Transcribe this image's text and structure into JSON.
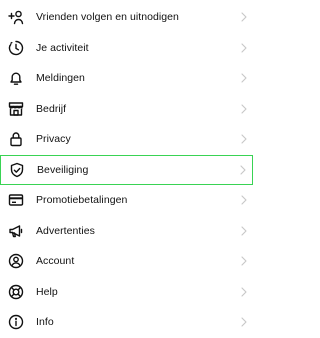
{
  "menu": {
    "items": [
      {
        "label": "Vrienden volgen en uitnodigen",
        "icon": "add-person-icon"
      },
      {
        "label": "Je activiteit",
        "icon": "activity-clock-icon"
      },
      {
        "label": "Meldingen",
        "icon": "bell-icon"
      },
      {
        "label": "Bedrijf",
        "icon": "store-icon"
      },
      {
        "label": "Privacy",
        "icon": "lock-icon"
      },
      {
        "label": "Beveiliging",
        "icon": "shield-check-icon"
      },
      {
        "label": "Promotiebetalingen",
        "icon": "credit-card-icon"
      },
      {
        "label": "Advertenties",
        "icon": "megaphone-icon"
      },
      {
        "label": "Account",
        "icon": "account-icon"
      },
      {
        "label": "Help",
        "icon": "lifebuoy-icon"
      },
      {
        "label": "Info",
        "icon": "info-icon"
      }
    ],
    "highlight_color": "#39d353",
    "chevron_color": "#c7c7c7"
  }
}
